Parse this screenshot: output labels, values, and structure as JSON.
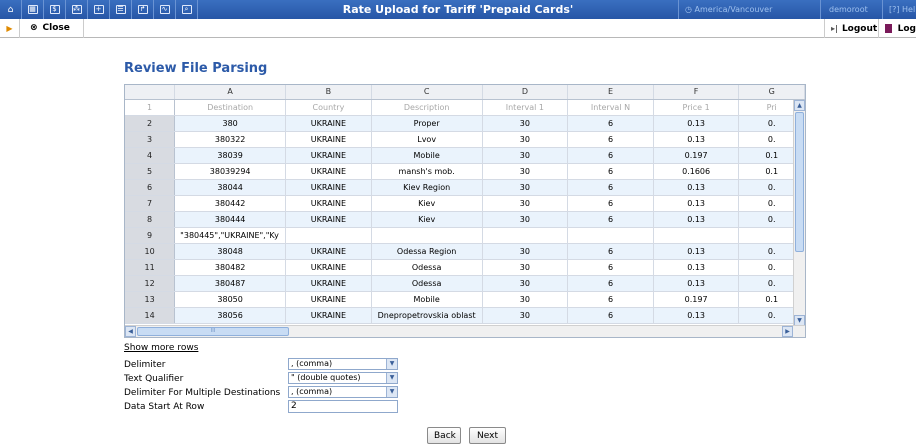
{
  "topbar": {
    "title": "Rate Upload for Tariff 'Prepaid Cards'",
    "timezone": "America/Vancouver",
    "user": "demoroot",
    "help": "Hel",
    "icons": [
      "home-icon",
      "grid-icon",
      "dollar-icon",
      "network-icon",
      "plus-icon",
      "user-icon",
      "phone-icon",
      "chart-icon",
      "search-icon"
    ]
  },
  "toolbar": {
    "close_label": "Close",
    "logout_label": "Logout",
    "log_label": "Log"
  },
  "heading": "Review File Parsing",
  "grid": {
    "columns": [
      "A",
      "B",
      "C",
      "D",
      "E",
      "F",
      "G"
    ],
    "header_row": {
      "num": "1",
      "cells": [
        "Destination",
        "Country",
        "Description",
        "Interval 1",
        "Interval N",
        "Price 1",
        "Pri"
      ]
    },
    "rows": [
      {
        "num": "2",
        "cells": [
          "380",
          "UKRAINE",
          "Proper",
          "30",
          "6",
          "0.13",
          "0."
        ]
      },
      {
        "num": "3",
        "cells": [
          "380322",
          "UKRAINE",
          "Lvov",
          "30",
          "6",
          "0.13",
          "0."
        ]
      },
      {
        "num": "4",
        "cells": [
          "38039",
          "UKRAINE",
          "Mobile",
          "30",
          "6",
          "0.197",
          "0.1"
        ]
      },
      {
        "num": "5",
        "cells": [
          "38039294",
          "UKRAINE",
          "mansh's mob.",
          "30",
          "6",
          "0.1606",
          "0.1"
        ]
      },
      {
        "num": "6",
        "cells": [
          "38044",
          "UKRAINE",
          "Kiev Region",
          "30",
          "6",
          "0.13",
          "0."
        ]
      },
      {
        "num": "7",
        "cells": [
          "380442",
          "UKRAINE",
          "Kiev",
          "30",
          "6",
          "0.13",
          "0."
        ]
      },
      {
        "num": "8",
        "cells": [
          "380444",
          "UKRAINE",
          "Kiev",
          "30",
          "6",
          "0.13",
          "0."
        ]
      },
      {
        "num": "9",
        "cells": [
          "\"380445\",\"UKRAINE\",\"Ky",
          "",
          "",
          "",
          "",
          "",
          ""
        ]
      },
      {
        "num": "10",
        "cells": [
          "38048",
          "UKRAINE",
          "Odessa Region",
          "30",
          "6",
          "0.13",
          "0."
        ]
      },
      {
        "num": "11",
        "cells": [
          "380482",
          "UKRAINE",
          "Odessa",
          "30",
          "6",
          "0.13",
          "0."
        ]
      },
      {
        "num": "12",
        "cells": [
          "380487",
          "UKRAINE",
          "Odessa",
          "30",
          "6",
          "0.13",
          "0."
        ]
      },
      {
        "num": "13",
        "cells": [
          "38050",
          "UKRAINE",
          "Mobile",
          "30",
          "6",
          "0.197",
          "0.1"
        ]
      },
      {
        "num": "14",
        "cells": [
          "38056",
          "UKRAINE",
          "Dnepropetrovskia oblast",
          "30",
          "6",
          "0.13",
          "0."
        ]
      }
    ],
    "hscroll_thumb_text": "III"
  },
  "show_more": "Show more rows",
  "form": {
    "delimiter_label": "Delimiter",
    "delimiter_value": ", (comma)",
    "qualifier_label": "Text Qualifier",
    "qualifier_value": "\" (double quotes)",
    "multi_dest_label": "Delimiter For Multiple Destinations",
    "multi_dest_value": ", (comma)",
    "start_row_label": "Data Start At Row",
    "start_row_value": "2"
  },
  "buttons": {
    "back": "Back",
    "next": "Next"
  },
  "colors": {
    "topbar": "#2f63b4",
    "heading": "#2c5aa8",
    "alt_row": "#eaf3fc"
  }
}
